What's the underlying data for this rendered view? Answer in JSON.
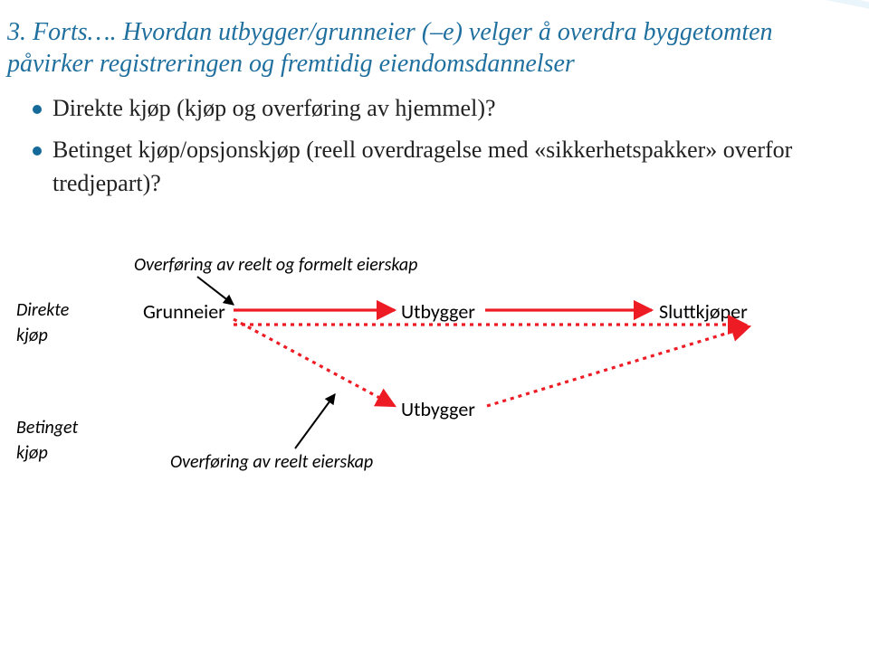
{
  "title": "3. Forts…. Hvordan utbygger/grunneier (–e) velger å overdra byggetomten påvirker registreringen og fremtidig eiendomsdannelser",
  "bullets": [
    "Direkte kjøp (kjøp og overføring av hjemmel)?",
    "Betinget kjøp/opsjonskjøp (reell overdragelse med «sikkerhetspakker» overfor tredjepart)?"
  ],
  "diagram": {
    "top_caption": "Overføring av reelt og formelt eierskap",
    "left_label_1a": "Direkte",
    "left_label_1b": "kjøp",
    "left_label_2a": "Betinget",
    "left_label_2b": "kjøp",
    "node_grunneier": "Grunneier",
    "node_utbygger1": "Utbygger",
    "node_sluttkjoper": "Sluttkjøper",
    "node_utbygger2": "Utbygger",
    "bottom_caption": "Overføring av reelt eierskap"
  },
  "colors": {
    "title": "#1f6f9f",
    "bullet_dot": "#156a9a",
    "arrow_red": "#ED1C24"
  }
}
